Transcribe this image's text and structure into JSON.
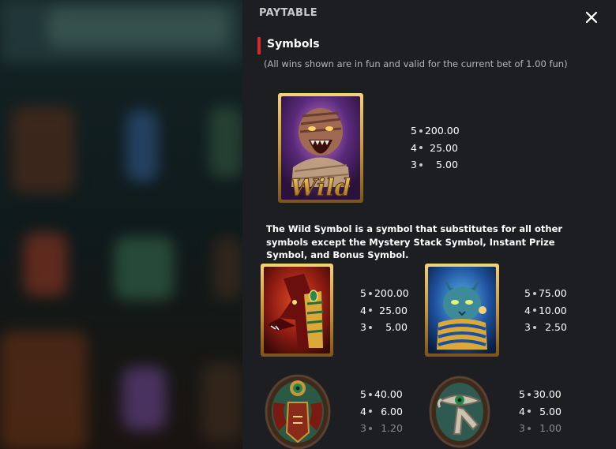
{
  "panel": {
    "title": "PAYTABLE",
    "close_icon": "close-icon"
  },
  "section": {
    "title": "Symbols",
    "note": "(All wins shown are in fun and valid for the current bet of 1.00 fun)"
  },
  "wild": {
    "icon": "wild-mummy-symbol",
    "label": "Wild",
    "pays": [
      {
        "count": "5",
        "value": "200.00"
      },
      {
        "count": "4",
        "value": "25.00"
      },
      {
        "count": "3",
        "value": "5.00"
      }
    ],
    "description": "The Wild Symbol is a symbol that substitutes for all other symbols except the Mystery Stack Symbol, Instant Prize Symbol, and Bonus Symbol."
  },
  "symbols": [
    {
      "icon": "anubis-symbol",
      "pays": [
        {
          "count": "5",
          "value": "200.00"
        },
        {
          "count": "4",
          "value": "25.00"
        },
        {
          "count": "3",
          "value": "5.00"
        }
      ]
    },
    {
      "icon": "bastet-cat-symbol",
      "pays": [
        {
          "count": "5",
          "value": "75.00"
        },
        {
          "count": "4",
          "value": "10.00"
        },
        {
          "count": "3",
          "value": "2.50"
        }
      ]
    },
    {
      "icon": "scarab-amulet-symbol",
      "pays": [
        {
          "count": "5",
          "value": "40.00"
        },
        {
          "count": "4",
          "value": "6.00"
        },
        {
          "count": "3",
          "value": "1.20"
        }
      ]
    },
    {
      "icon": "eye-of-horus-amulet-symbol",
      "pays": [
        {
          "count": "5",
          "value": "30.00"
        },
        {
          "count": "4",
          "value": "5.00"
        },
        {
          "count": "3",
          "value": "1.00"
        }
      ]
    }
  ],
  "colors": {
    "panel_bg": "#1d1e21",
    "accent_red": "#d5292b",
    "gold": "#c9973a"
  }
}
